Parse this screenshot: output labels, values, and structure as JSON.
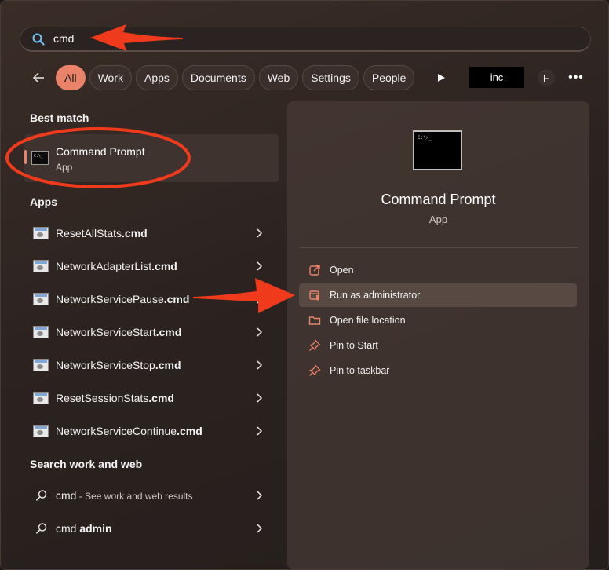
{
  "search": {
    "query": "cmd"
  },
  "filters": {
    "items": [
      "All",
      "Work",
      "Apps",
      "Documents",
      "Web",
      "Settings",
      "People"
    ],
    "active": "All",
    "org_label": "inc",
    "avatar_letter": "F",
    "more_label": "•••"
  },
  "best_match": {
    "heading": "Best match",
    "name": "Command Prompt",
    "type": "App"
  },
  "apps": {
    "heading": "Apps",
    "items": [
      {
        "name": "ResetAllStats",
        "ext": ".cmd"
      },
      {
        "name": "NetworkAdapterList",
        "ext": ".cmd"
      },
      {
        "name": "NetworkServicePause",
        "ext": ".cmd"
      },
      {
        "name": "NetworkServiceStart",
        "ext": ".cmd"
      },
      {
        "name": "NetworkServiceStop",
        "ext": ".cmd"
      },
      {
        "name": "ResetSessionStats",
        "ext": ".cmd"
      },
      {
        "name": "NetworkServiceContinue",
        "ext": ".cmd"
      }
    ]
  },
  "web": {
    "heading": "Search work and web",
    "items": [
      {
        "query": "cmd",
        "suffix": " - See work and web results"
      },
      {
        "query": "cmd ",
        "bold": "admin"
      }
    ]
  },
  "detail": {
    "title": "Command Prompt",
    "type": "App",
    "actions": [
      "Open",
      "Run as administrator",
      "Open file location",
      "Pin to Start",
      "Pin to taskbar"
    ]
  },
  "colors": {
    "accent": "#e9846b",
    "annotation": "#f03a1c"
  }
}
